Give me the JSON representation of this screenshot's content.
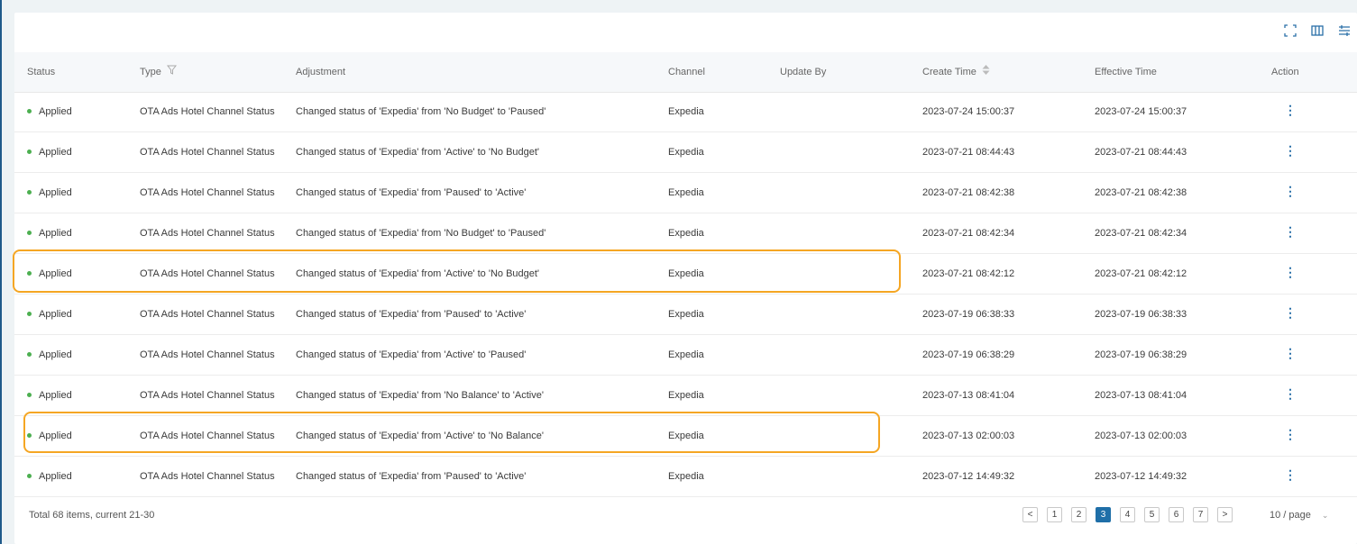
{
  "columns": {
    "status": "Status",
    "type": "Type",
    "adjustment": "Adjustment",
    "channel": "Channel",
    "update_by": "Update By",
    "create_time": "Create Time",
    "effective_time": "Effective Time",
    "action": "Action"
  },
  "rows": [
    {
      "status": "Applied",
      "type": "OTA Ads Hotel Channel Status",
      "adjustment": "Changed status of 'Expedia' from 'No Budget' to 'Paused'",
      "channel": "Expedia",
      "update_by": "",
      "create_time": "2023-07-24 15:00:37",
      "effective_time": "2023-07-24 15:00:37"
    },
    {
      "status": "Applied",
      "type": "OTA Ads Hotel Channel Status",
      "adjustment": "Changed status of 'Expedia' from 'Active' to 'No Budget'",
      "channel": "Expedia",
      "update_by": "",
      "create_time": "2023-07-21 08:44:43",
      "effective_time": "2023-07-21 08:44:43"
    },
    {
      "status": "Applied",
      "type": "OTA Ads Hotel Channel Status",
      "adjustment": "Changed status of 'Expedia' from 'Paused' to 'Active'",
      "channel": "Expedia",
      "update_by": "",
      "create_time": "2023-07-21 08:42:38",
      "effective_time": "2023-07-21 08:42:38"
    },
    {
      "status": "Applied",
      "type": "OTA Ads Hotel Channel Status",
      "adjustment": "Changed status of 'Expedia' from 'No Budget' to 'Paused'",
      "channel": "Expedia",
      "update_by": "",
      "create_time": "2023-07-21 08:42:34",
      "effective_time": "2023-07-21 08:42:34"
    },
    {
      "status": "Applied",
      "type": "OTA Ads Hotel Channel Status",
      "adjustment": "Changed status of 'Expedia' from 'Active' to 'No Budget'",
      "channel": "Expedia",
      "update_by": "",
      "create_time": "2023-07-21 08:42:12",
      "effective_time": "2023-07-21 08:42:12"
    },
    {
      "status": "Applied",
      "type": "OTA Ads Hotel Channel Status",
      "adjustment": "Changed status of 'Expedia' from 'Paused' to 'Active'",
      "channel": "Expedia",
      "update_by": "",
      "create_time": "2023-07-19 06:38:33",
      "effective_time": "2023-07-19 06:38:33"
    },
    {
      "status": "Applied",
      "type": "OTA Ads Hotel Channel Status",
      "adjustment": "Changed status of 'Expedia' from 'Active' to 'Paused'",
      "channel": "Expedia",
      "update_by": "",
      "create_time": "2023-07-19 06:38:29",
      "effective_time": "2023-07-19 06:38:29"
    },
    {
      "status": "Applied",
      "type": "OTA Ads Hotel Channel Status",
      "adjustment": "Changed status of 'Expedia' from 'No Balance' to 'Active'",
      "channel": "Expedia",
      "update_by": "",
      "create_time": "2023-07-13 08:41:04",
      "effective_time": "2023-07-13 08:41:04"
    },
    {
      "status": "Applied",
      "type": "OTA Ads Hotel Channel Status",
      "adjustment": "Changed status of 'Expedia' from 'Active' to 'No Balance'",
      "channel": "Expedia",
      "update_by": "",
      "create_time": "2023-07-13 02:00:03",
      "effective_time": "2023-07-13 02:00:03"
    },
    {
      "status": "Applied",
      "type": "OTA Ads Hotel Channel Status",
      "adjustment": "Changed status of 'Expedia' from 'Paused' to 'Active'",
      "channel": "Expedia",
      "update_by": "",
      "create_time": "2023-07-12 14:49:32",
      "effective_time": "2023-07-12 14:49:32"
    }
  ],
  "footer": {
    "total_text": "Total 68 items, current 21-30",
    "pages": [
      "1",
      "2",
      "3",
      "4",
      "5",
      "6",
      "7"
    ],
    "active_page": "3",
    "prev_glyph": "<",
    "next_glyph": ">",
    "page_size": "10 / page"
  },
  "colors": {
    "highlight": "#f5a623",
    "status_dot": "#4caf50",
    "active_page_bg": "#1f6fa8"
  }
}
